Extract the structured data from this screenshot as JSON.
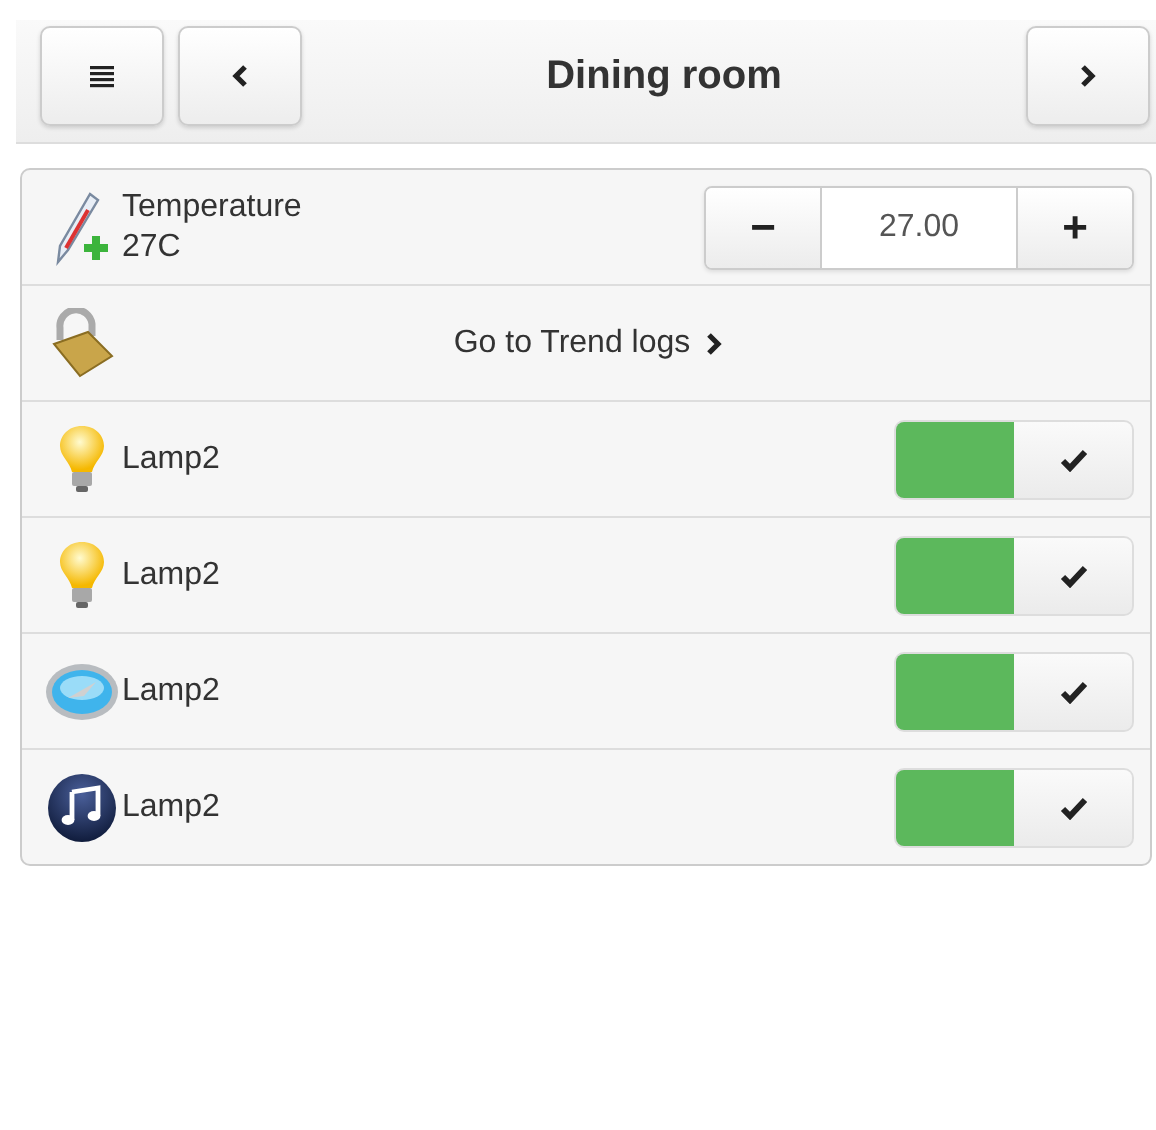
{
  "header": {
    "title": "Dining room"
  },
  "stepper": {
    "label": "Temperature",
    "reading": "27C",
    "minus": "−",
    "value": "27.00",
    "plus": "+"
  },
  "link": {
    "label": "Go to Trend logs"
  },
  "devices": [
    {
      "name": "Lamp2",
      "kind": "bulb",
      "on": true
    },
    {
      "name": "Lamp2",
      "kind": "bulb",
      "on": true
    },
    {
      "name": "Lamp2",
      "kind": "compass",
      "on": true
    },
    {
      "name": "Lamp2",
      "kind": "music",
      "on": true
    }
  ]
}
